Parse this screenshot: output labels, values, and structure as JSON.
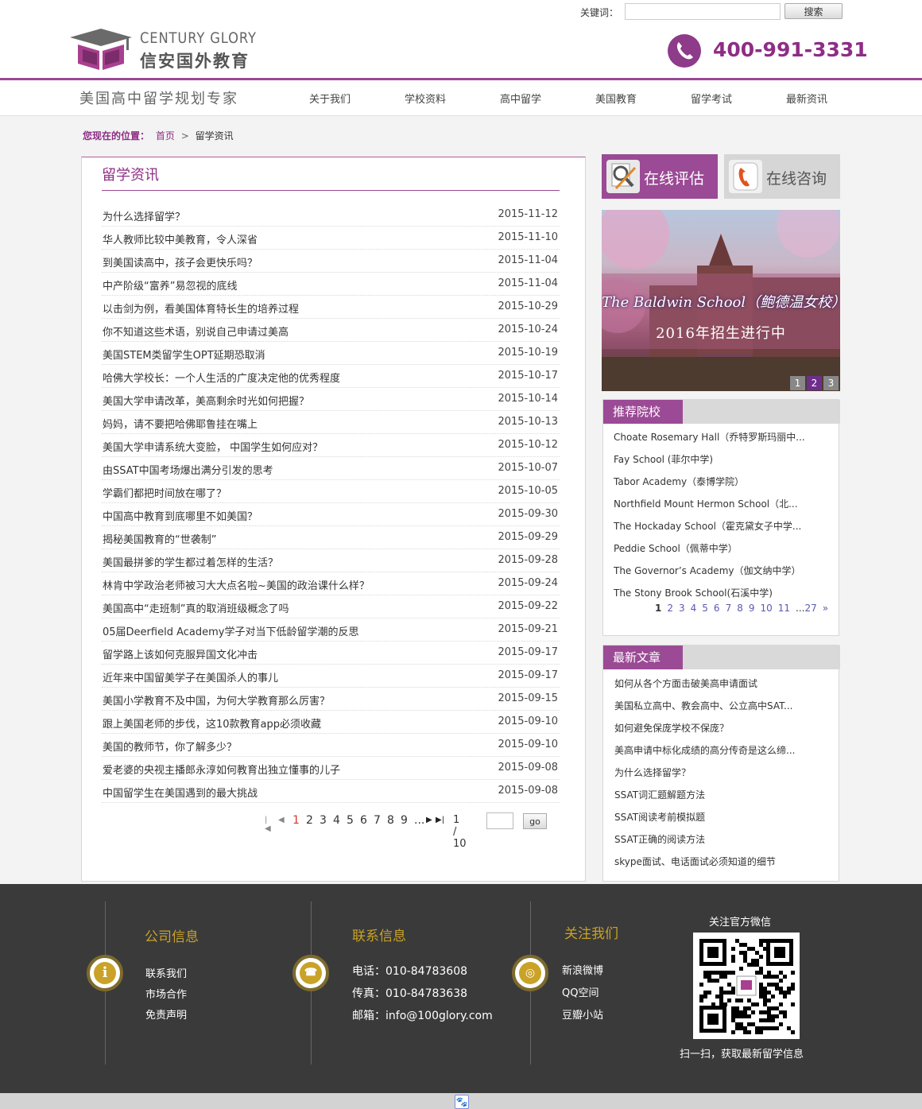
{
  "header": {
    "keyword_label": "关键词：",
    "search_placeholder": "",
    "search_button": "搜索",
    "logo_en": "CENTURY GLORY",
    "logo_cn": "信安国外教育",
    "phone": "400-991-3331"
  },
  "nav": {
    "slogan": "美国高中留学规划专家",
    "items": [
      "关于我们",
      "学校资料",
      "高中留学",
      "美国教育",
      "留学考试",
      "最新资讯"
    ]
  },
  "breadcrumb": {
    "label": "您现在的位置：",
    "home": "首页",
    "separator": ">",
    "current": "留学资讯"
  },
  "main": {
    "title": "留学资讯",
    "news": [
      {
        "title": "为什么选择留学？",
        "date": "2015-11-12"
      },
      {
        "title": "华人教师比较中美教育，令人深省",
        "date": "2015-11-10"
      },
      {
        "title": "到美国读高中，孩子会更快乐吗？",
        "date": "2015-11-04"
      },
      {
        "title": "中产阶级“富养”易忽视的底线",
        "date": "2015-11-04"
      },
      {
        "title": "以击剑为例，看美国体育特长生的培养过程",
        "date": "2015-10-29"
      },
      {
        "title": "你不知道这些术语，别说自己申请过美高",
        "date": "2015-10-24"
      },
      {
        "title": "美国STEM类留学生OPT延期恐取消",
        "date": "2015-10-19"
      },
      {
        "title": "哈佛大学校长：一个人生活的广度决定他的优秀程度",
        "date": "2015-10-17"
      },
      {
        "title": "美国大学申请改革，美高剩余时光如何把握？",
        "date": "2015-10-14"
      },
      {
        "title": "妈妈，请不要把哈佛耶鲁挂在嘴上",
        "date": "2015-10-13"
      },
      {
        "title": "美国大学申请系统大变脸， 中国学生如何应对？",
        "date": "2015-10-12"
      },
      {
        "title": "由SSAT中国考场爆出满分引发的思考",
        "date": "2015-10-07"
      },
      {
        "title": "学霸们都把时间放在哪了？",
        "date": "2015-10-05"
      },
      {
        "title": "中国高中教育到底哪里不如美国？",
        "date": "2015-09-30"
      },
      {
        "title": "揭秘美国教育的“世袭制”",
        "date": "2015-09-29"
      },
      {
        "title": "美国最拼爹的学生都过着怎样的生活？",
        "date": "2015-09-28"
      },
      {
        "title": "林肯中学政治老师被习大大点名啦~美国的政治课什么样？",
        "date": "2015-09-24"
      },
      {
        "title": "美国高中“走班制”真的取消班级概念了吗",
        "date": "2015-09-22"
      },
      {
        "title": "05届Deerfield Academy学子对当下低龄留学潮的反思",
        "date": "2015-09-21"
      },
      {
        "title": "留学路上该如何克服异国文化冲击",
        "date": "2015-09-17"
      },
      {
        "title": "近年来中国留美学子在美国杀人的事儿",
        "date": "2015-09-17"
      },
      {
        "title": "美国小学教育不及中国，为何大学教育那么厉害？",
        "date": "2015-09-15"
      },
      {
        "title": "跟上美国老师的步伐，这10款教育app必须收藏",
        "date": "2015-09-10"
      },
      {
        "title": "美国的教师节，你了解多少？",
        "date": "2015-09-10"
      },
      {
        "title": "爱老婆的央视主播郎永淳如何教育出独立懂事的儿子",
        "date": "2015-09-08"
      },
      {
        "title": "中国留学生在美国遇到的最大挑战",
        "date": "2015-09-08"
      }
    ],
    "pager": {
      "pages": [
        "1",
        "2",
        "3",
        "4",
        "5",
        "6",
        "7",
        "8",
        "9",
        "..."
      ],
      "current": "1",
      "status": "1 / 10",
      "go_label": "go"
    }
  },
  "sidebar": {
    "eval_label": "在线评估",
    "consult_label": "在线咨询",
    "banner": {
      "title_en": "The Baldwin School（鲍德温女校）",
      "subtitle": "2016年招生进行中",
      "dots": [
        "1",
        "2",
        "3"
      ],
      "active_dot": "2"
    },
    "schools": {
      "heading": "推荐院校",
      "items": [
        "Choate Rosemary Hall（乔特罗斯玛丽中...",
        "Fay School (菲尔中学)",
        "Tabor Academy（泰博学院）",
        "Northfield Mount Hermon School（北...",
        "The Hockaday School（霍克黛女子中学...",
        "Peddie School（佩蒂中学）",
        "The Governor’s Academy（伽文纳中学）",
        "The Stony Brook School(石溪中学)"
      ],
      "pager": [
        "1",
        "2",
        "3",
        "4",
        "5",
        "6",
        "7",
        "8",
        "9",
        "10",
        "11",
        "...",
        "27",
        "»"
      ]
    },
    "articles": {
      "heading": "最新文章",
      "items": [
        "如何从各个方面击破美高申请面试",
        "美国私立高中、教会高中、公立高中SAT...",
        "如何避免保庞学校不保庞？",
        "美高申请中标化成绩的高分传奇是这么缔...",
        "为什么选择留学？",
        "SSAT词汇题解题方法",
        "SSAT阅读考前模拟题",
        "SSAT正确的阅读方法",
        "skype面试、电话面试必须知道的细节"
      ]
    }
  },
  "footer": {
    "company": {
      "title": "公司信息",
      "links": [
        "联系我们",
        "市场合作",
        "免责声明"
      ]
    },
    "contact": {
      "title": "联系信息",
      "phone": "电话：010-84783608",
      "fax": "传真：010-84783638",
      "email": "邮箱：info@100glory.com"
    },
    "follow": {
      "title": "关注我们",
      "links": [
        "新浪微博",
        "QQ空间",
        "豆瓣小站"
      ]
    },
    "qr_title": "关注官方微信",
    "qr_caption": "扫一扫，获取最新留学信息"
  },
  "colors": {
    "brand": "#9b4a95",
    "brand_dark": "#8e2d85",
    "footer_bg": "#3a3a3a",
    "footer_accent": "#c9a227"
  }
}
